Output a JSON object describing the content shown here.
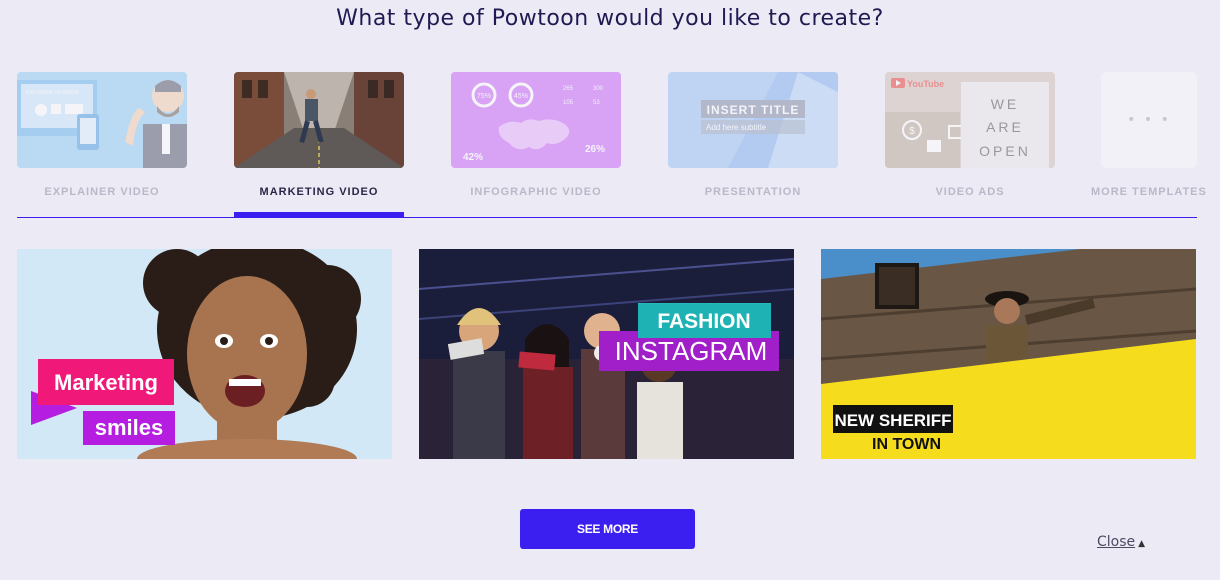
{
  "heading": "What type of Powtoon would you like to create?",
  "categories": [
    {
      "label": "EXPLAINER VIDEO",
      "thumb_text": "SOFTWARE UPGRADE"
    },
    {
      "label": "MARKETING VIDEO"
    },
    {
      "label": "INFOGRAPHIC VIDEO",
      "stats": [
        "75%",
        "45%",
        "265",
        "300",
        "105",
        "53",
        "42%",
        "26%"
      ]
    },
    {
      "label": "PRESENTATION",
      "title": "INSERT TITLE",
      "subtitle": "Add here subtitle"
    },
    {
      "label": "VIDEO ADS",
      "brand": "YouTube",
      "sign": [
        "WE",
        "ARE",
        "OPEN"
      ]
    },
    {
      "label": "MORE TEMPLATES",
      "dots": "• • •"
    }
  ],
  "active_category": "MARKETING VIDEO",
  "templates": [
    {
      "line1": "Marketing",
      "line2": "smiles"
    },
    {
      "line1": "INSTAGRAM",
      "line2": "FASHION"
    },
    {
      "line1": "NEW SHERIFF",
      "line2": "IN TOWN"
    }
  ],
  "see_more_label": "SEE MORE",
  "close_label": "Close",
  "close_arrow": "▲",
  "colors": {
    "accent": "#3a1ff0",
    "background": "#ecebf5"
  }
}
